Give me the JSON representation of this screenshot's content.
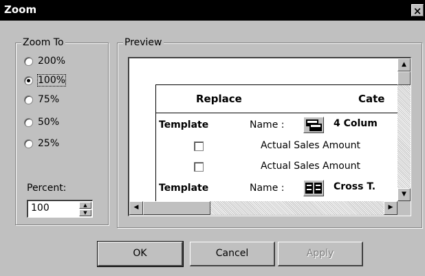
{
  "window": {
    "title": "Zoom",
    "close_label": "×"
  },
  "zoom_to": {
    "label": "Zoom To",
    "options": [
      {
        "label": "200%",
        "selected": false
      },
      {
        "label": "100%",
        "selected": true
      },
      {
        "label": "75%",
        "selected": false
      },
      {
        "label": "50%",
        "selected": false
      },
      {
        "label": "25%",
        "selected": false
      }
    ],
    "percent_label": "Percent:",
    "percent_value": "100"
  },
  "preview": {
    "label": "Preview",
    "header": {
      "replace": "Replace",
      "category": "Cate"
    },
    "rows": [
      {
        "template": "Template",
        "name_label": "Name :",
        "name_value": "4 Colum"
      },
      {
        "checkbox_label": "Actual Sales Amount"
      },
      {
        "checkbox_label": "Actual Sales Amount"
      },
      {
        "template": "Template",
        "name_label": "Name :",
        "name_value": "Cross T."
      }
    ]
  },
  "buttons": {
    "ok": "OK",
    "cancel": "Cancel",
    "apply": "Apply"
  }
}
